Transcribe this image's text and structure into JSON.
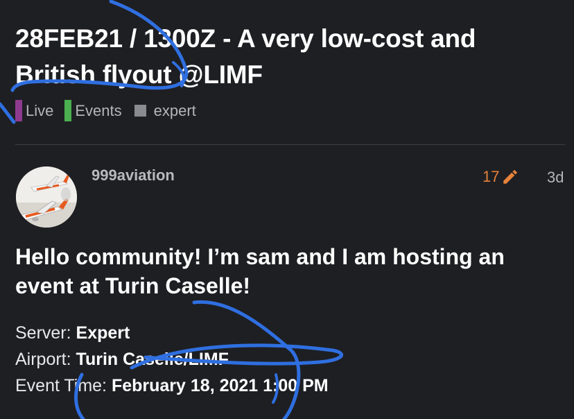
{
  "topic": {
    "title": "28FEB21 / 1300Z - A very low-cost and British flyout @LIMF"
  },
  "tags": [
    {
      "label": "Live",
      "color": "#8e3a8e",
      "style": "bar"
    },
    {
      "label": "Events",
      "color": "#4caf50",
      "style": "bar"
    },
    {
      "label": "expert",
      "color": "#8a8b90",
      "style": "square"
    }
  ],
  "post": {
    "username": "999aviation",
    "edit_count": "17",
    "age": "3d",
    "headline": "Hello community! I’m sam and I am hosting an event at Turin Caselle!",
    "details": [
      {
        "label": "Server: ",
        "value": "Expert"
      },
      {
        "label": "Airport: ",
        "value": "Turin Caselle/LIMF"
      },
      {
        "label": "Event Time: ",
        "value": "February 18, 2021 1:00 PM"
      }
    ]
  },
  "colors": {
    "background": "#1e1f23",
    "accent_orange": "#e6823a",
    "scribble_blue": "#2f6fe0"
  }
}
